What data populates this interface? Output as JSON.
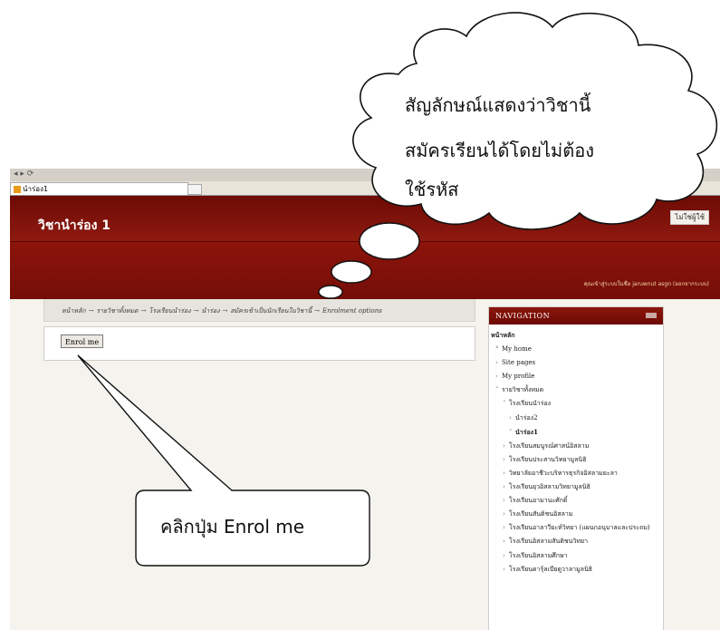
{
  "browser": {
    "tab_title": "นำร่อง1"
  },
  "header": {
    "course_title": "วิชานำร่อง 1",
    "button_label": "ไม่ใช่ผู้ใช้",
    "login_info": "คุณเข้าสู่ระบบในชื่อ jaruwnut asgn (ออกจากระบบ)"
  },
  "breadcrumb": [
    "หน้าหลัก",
    "รายวิชาทั้งหมด",
    "โรงเรียนนำร่อง",
    "นำร่อง",
    "สมัครเข้าเป็นนักเรียนในวิชานี้",
    "Enrolment options"
  ],
  "breadcrumb_separator": "→",
  "enrol_button_label": "Enrol me",
  "navigation": {
    "title": "NAVIGATION",
    "items": [
      {
        "label": "หน้าหลัก",
        "level": 0,
        "bullet": "",
        "bold": true
      },
      {
        "label": "My home",
        "level": 0,
        "bullet": "°",
        "bold": false
      },
      {
        "label": "Site pages",
        "level": 0,
        "bullet": "›",
        "bold": false
      },
      {
        "label": "My profile",
        "level": 0,
        "bullet": "›",
        "bold": false
      },
      {
        "label": "รายวิชาทั้งหมด",
        "level": 0,
        "bullet": "˅",
        "bold": false
      },
      {
        "label": "โรงเรียนนำร่อง",
        "level": 1,
        "bullet": "˅",
        "bold": false
      },
      {
        "label": "นำร่อง2",
        "level": 2,
        "bullet": "›",
        "bold": false
      },
      {
        "label": "นำร่อง1",
        "level": 2,
        "bullet": "˅",
        "bold": true
      },
      {
        "label": "โรงเรียนสมบูรณ์ศาสน์อิสลาม",
        "level": 1,
        "bullet": "›",
        "bold": false
      },
      {
        "label": "โรงเรียนประสานวิทยามูลนิธิ",
        "level": 1,
        "bullet": "›",
        "bold": false
      },
      {
        "label": "วิทยาลัยอาชีวะบริหารธุรกิจอิสลามยะลา",
        "level": 1,
        "bullet": "›",
        "bold": false
      },
      {
        "label": "โรงเรียนยุวอิสลามวิทยามูลนิธิ",
        "level": 1,
        "bullet": "›",
        "bold": false
      },
      {
        "label": "โรงเรียนอามานะศักดิ์",
        "level": 1,
        "bullet": "›",
        "bold": false
      },
      {
        "label": "โรงเรียนสันติชนอิสลาม",
        "level": 1,
        "bullet": "›",
        "bold": false
      },
      {
        "label": "โรงเรียนอาลาวียะห์วิทยา (แผนกอนุบาลและประถม)",
        "level": 1,
        "bullet": "›",
        "bold": false
      },
      {
        "label": "โรงเรียนอิสลามสันติชนวิทยา",
        "level": 1,
        "bullet": "›",
        "bold": false
      },
      {
        "label": "โรงเรียนอิสลามศึกษา",
        "level": 1,
        "bullet": "›",
        "bold": false
      },
      {
        "label": "โรงเรียนดารุ้ลเบียดูวาลามูลนิธิ",
        "level": 1,
        "bullet": "›",
        "bold": false
      }
    ]
  },
  "annotations": {
    "cloud_lines": [
      "สัญลักษณ์แสดงว่าวิชานี้",
      "สมัครเรียนได้โดยไม่ต้อง",
      "ใช้รหัส"
    ],
    "callout_text": "คลิกปุ่ม Enrol me"
  },
  "colors": {
    "header_maroon": "#7a120b",
    "content_bg": "#f4f3ee"
  }
}
